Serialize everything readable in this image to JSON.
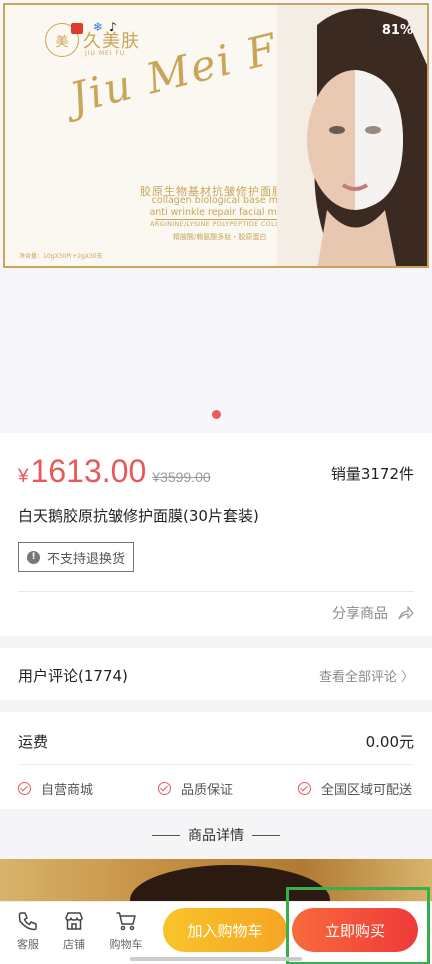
{
  "status_bar": {
    "battery": "81%"
  },
  "banner": {
    "brand_name": "久美肤",
    "brand_sub": "JIU MEI FU",
    "logo_mark": "美",
    "script_title": "Jiu Mei Fu",
    "cn_title": "胶原生物基材抗皱修护面膜套装",
    "en_title": "collagen biological base material anti wrinkle repair facial mask set",
    "ingredient_en": "ARGININE/LYSINE POLYPEPTIDE COLLAGEN",
    "ingredient_cn": "精胺酸/赖氨酸多肽・胶原蛋白",
    "net_content": "净含量：10gX30片+2gX30支",
    "accent_color": "#c9a559"
  },
  "product": {
    "currency": "¥",
    "price": "1613.00",
    "original_price": "¥3599.00",
    "sales": "销量3172件",
    "name": "白天鹅胶原抗皱修护面膜(30片套装)",
    "no_return_label": "不支持退换货",
    "share_label": "分享商品",
    "price_color": "#e85a5a"
  },
  "reviews": {
    "label": "用户评论(1774)",
    "view_all": "查看全部评论",
    "chevron": "〉"
  },
  "shipping": {
    "label": "运费",
    "value": "0.00元",
    "guarantees": [
      "自营商城",
      "品质保证",
      "全国区域可配送"
    ]
  },
  "details": {
    "heading": "商品详情"
  },
  "bottom_bar": {
    "service": "客服",
    "store": "店铺",
    "cart": "购物车",
    "add_to_cart": "加入购物车",
    "buy_now": "立即购买"
  }
}
